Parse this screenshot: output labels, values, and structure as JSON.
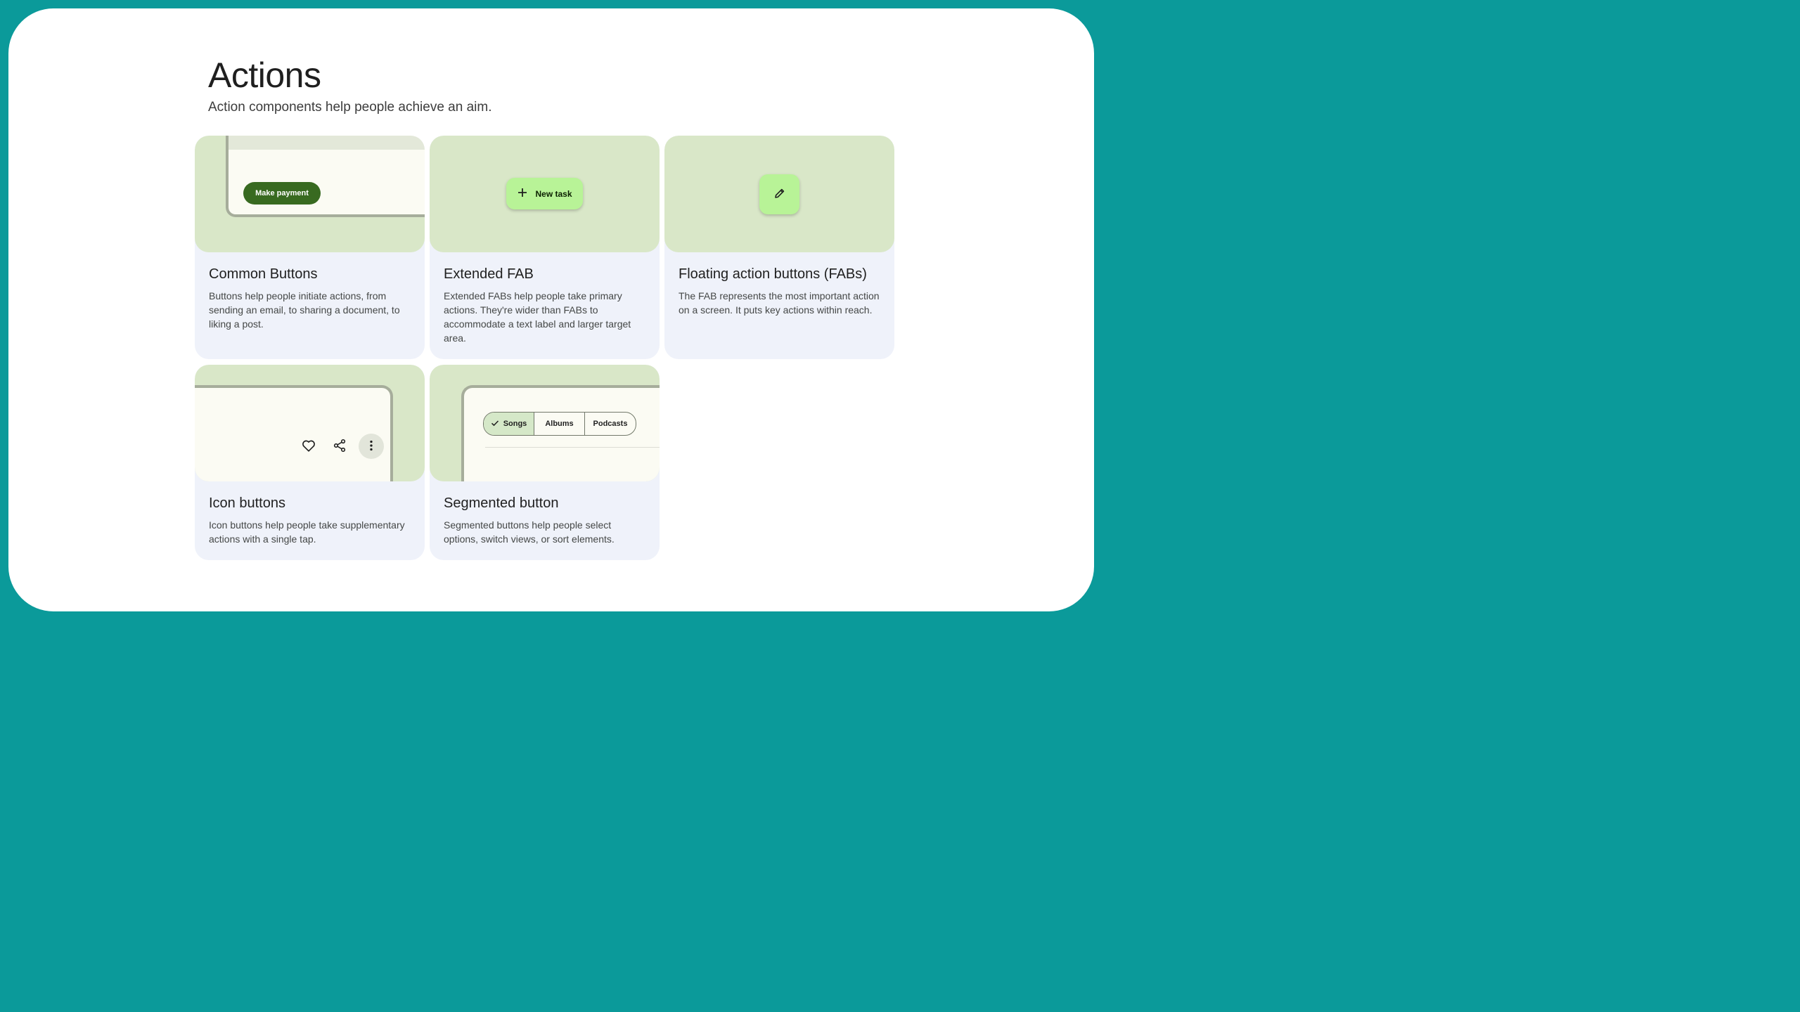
{
  "page": {
    "title": "Actions",
    "subtitle": "Action components help people achieve an aim."
  },
  "cards": [
    {
      "title": "Common Buttons",
      "description": "Buttons help people initiate actions, from sending an email, to sharing a document, to liking a post.",
      "preview": {
        "button_label": "Make payment"
      }
    },
    {
      "title": "Extended FAB",
      "description": "Extended FABs help people take primary actions. They're wider than FABs to accommodate a text label and larger target area.",
      "preview": {
        "icon": "plus-icon",
        "button_label": "New task"
      }
    },
    {
      "title": "Floating action buttons (FABs)",
      "description": "The FAB represents the most important action on a screen. It puts key actions within reach.",
      "preview": {
        "icon": "pencil-icon"
      }
    },
    {
      "title": "Icon buttons",
      "description": "Icon buttons help people take supplementary actions with a single tap.",
      "preview": {
        "icons": [
          "heart-icon",
          "share-icon",
          "more-vert-icon"
        ]
      }
    },
    {
      "title": "Segmented button",
      "description": "Segmented buttons help people select options, switch views, or sort elements.",
      "preview": {
        "segments": [
          "Songs",
          "Albums",
          "Podcasts"
        ],
        "selected": "Songs"
      }
    }
  ],
  "colors": {
    "frame": "#0b9a9a",
    "card_bg": "#eff2fa",
    "preview_bg": "#d9e7c8",
    "primary": "#386a20",
    "fab": "#b8f397"
  }
}
